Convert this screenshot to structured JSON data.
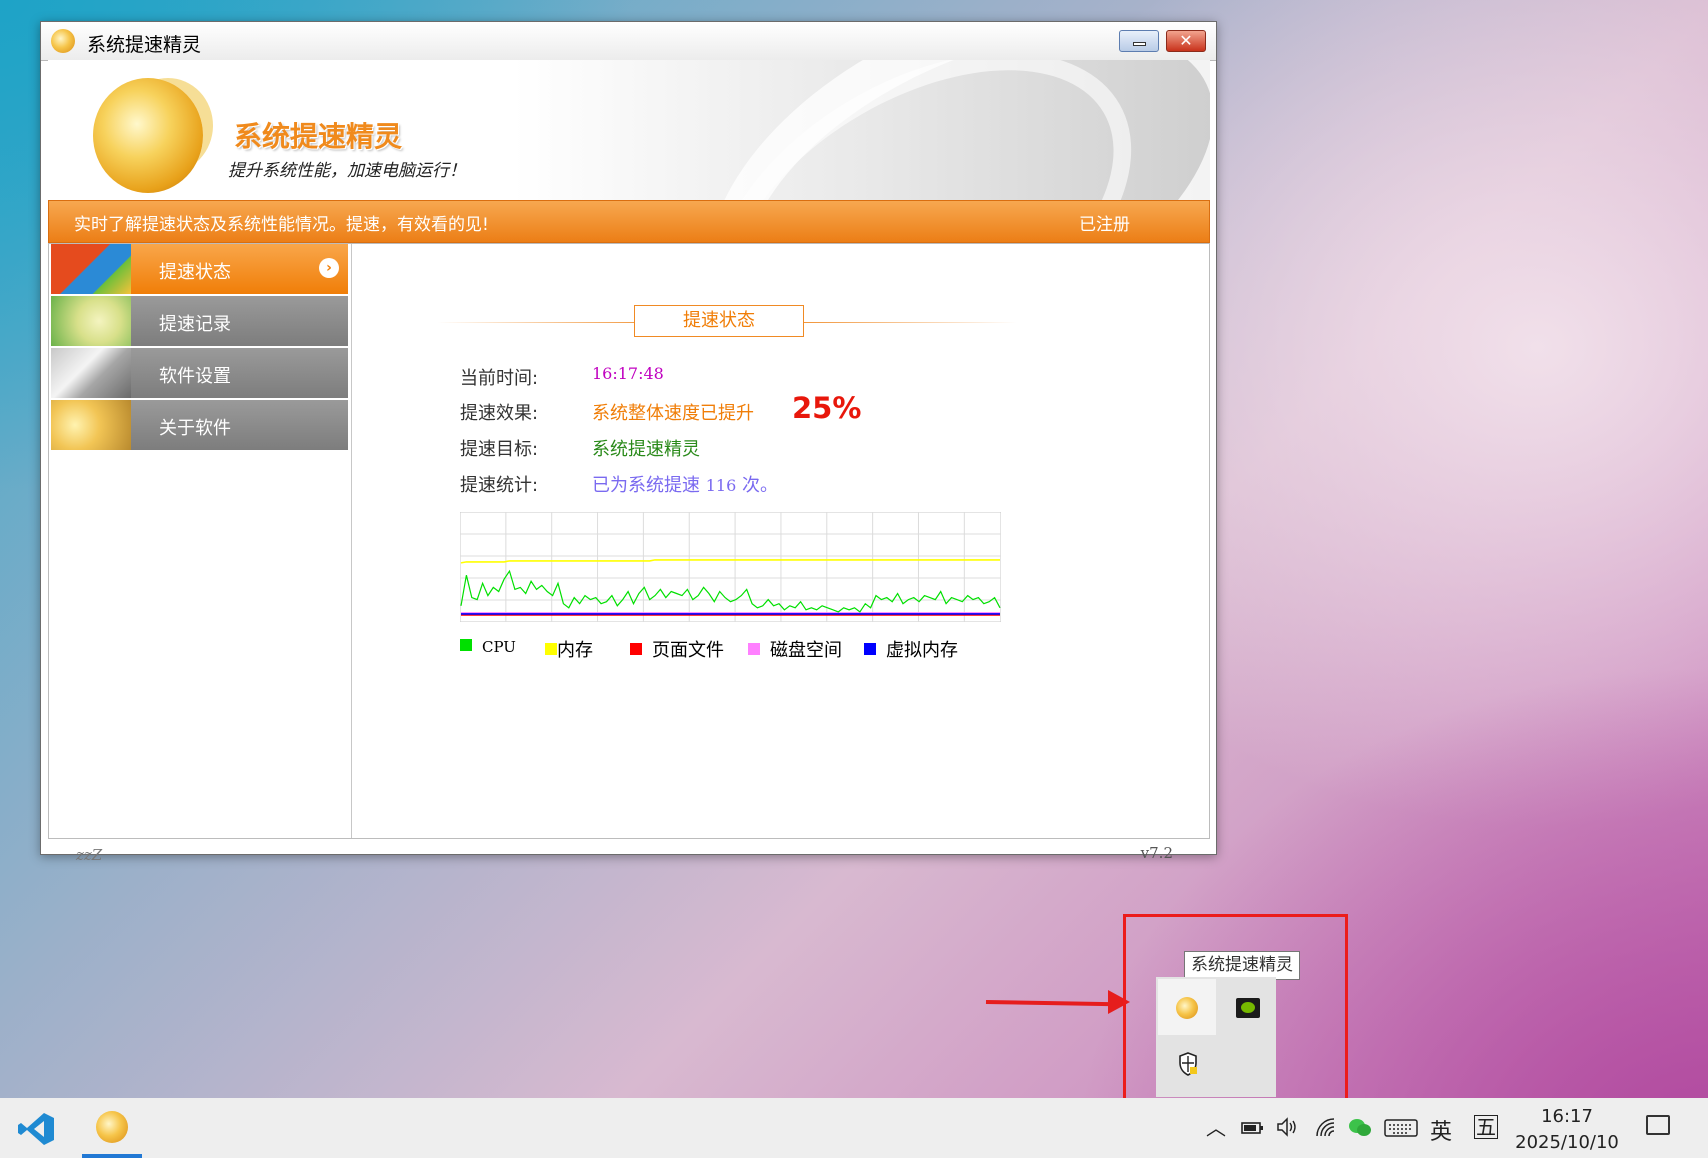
{
  "window": {
    "title": "系统提速精灵",
    "close_glyph": "✕"
  },
  "banner": {
    "title": "系统提速精灵",
    "subtitle": "提升系统性能，加速电脑运行！"
  },
  "info_bar": {
    "tip": "实时了解提速状态及系统性能情况。提速，有效看的见!",
    "registered": "已注册"
  },
  "sidebar": {
    "items": [
      {
        "label": "提速状态",
        "icon": "windows-logo-icon",
        "active": true
      },
      {
        "label": "提速记录",
        "icon": "record-icon",
        "active": false
      },
      {
        "label": "软件设置",
        "icon": "tools-icon",
        "active": false
      },
      {
        "label": "关于软件",
        "icon": "about-icon",
        "active": false
      }
    ],
    "active_arrow": "›"
  },
  "status_panel": {
    "section_title": "提速状态",
    "rows": [
      {
        "key": "当前时间:",
        "value": "16:17:48"
      },
      {
        "key": "提速效果:",
        "value": "系统整体速度已提升",
        "extra": "25%"
      },
      {
        "key": "提速目标:",
        "value": "系统提速精灵"
      },
      {
        "key": "提速统计:",
        "value_prefix": "已为系统提速",
        "value_num": "116",
        "value_suffix": "次。"
      }
    ]
  },
  "chart_data": {
    "type": "line",
    "title": "",
    "xlabel": "",
    "ylabel": "",
    "ylim": [
      0,
      100
    ],
    "grid": true,
    "legend": "bottom",
    "series": [
      {
        "name": "CPU",
        "color": "#00e000",
        "values": [
          12,
          42,
          20,
          18,
          34,
          22,
          30,
          26,
          38,
          46,
          28,
          30,
          24,
          36,
          28,
          32,
          26,
          22,
          34,
          14,
          10,
          20,
          14,
          22,
          18,
          20,
          14,
          16,
          22,
          12,
          18,
          26,
          14,
          24,
          30,
          18,
          22,
          28,
          20,
          26,
          24,
          22,
          28,
          18,
          22,
          30,
          24,
          16,
          26,
          20,
          16,
          18,
          22,
          28,
          14,
          10,
          12,
          18,
          12,
          14,
          8,
          12,
          10,
          16,
          8,
          10,
          8,
          12,
          10,
          8,
          6,
          10,
          8,
          10,
          6,
          14,
          10,
          22,
          18,
          20,
          16,
          24,
          14,
          18,
          20,
          16,
          22,
          20,
          18,
          26,
          14,
          20,
          18,
          16,
          22,
          18,
          20,
          14,
          16,
          20,
          10
        ]
      },
      {
        "name": "内存",
        "color": "#ffff00",
        "values": [
          54,
          55,
          55,
          55,
          55,
          55,
          55,
          55,
          55,
          56,
          56,
          56,
          56,
          56,
          56,
          56,
          56,
          56,
          56,
          56,
          56,
          56,
          56,
          56,
          56,
          56,
          56,
          56,
          56,
          56,
          56,
          56,
          56,
          56,
          56,
          56,
          57,
          57,
          57,
          57,
          57,
          57,
          57,
          57,
          57,
          57,
          57,
          57,
          57,
          57,
          57,
          57,
          57,
          57,
          57,
          57,
          57,
          57,
          57,
          57,
          57,
          57,
          57,
          57,
          57,
          57,
          57,
          57,
          57,
          57,
          57,
          57,
          57,
          57,
          57,
          57,
          57,
          57,
          57,
          57,
          57,
          57,
          57,
          57,
          57,
          57,
          57,
          57,
          57,
          57,
          57,
          57,
          57,
          57,
          57,
          57,
          57,
          57,
          57,
          57,
          57
        ]
      },
      {
        "name": "页面文件",
        "color": "#ff0000",
        "values": [
          3,
          3,
          3,
          3,
          3,
          3,
          3,
          3,
          3,
          3,
          3,
          3,
          3,
          3,
          3,
          3,
          3,
          3,
          3,
          3,
          3,
          3,
          3,
          3,
          3,
          3,
          3,
          3,
          3,
          3,
          3,
          3,
          3,
          3,
          3,
          3,
          3,
          3,
          3,
          3,
          3,
          3,
          3,
          3,
          3,
          3,
          3,
          3,
          3,
          3,
          3,
          3,
          3,
          3,
          3,
          3,
          3,
          3,
          3,
          3,
          3,
          3,
          3,
          3,
          3,
          3,
          3,
          3,
          3,
          3,
          3,
          3,
          3,
          3,
          3,
          3,
          3,
          3,
          3,
          3,
          3,
          3,
          3,
          3,
          3,
          3,
          3,
          3,
          3,
          3,
          3,
          3,
          3,
          3,
          3,
          3,
          3,
          3,
          3,
          3,
          3
        ]
      },
      {
        "name": "磁盘空间",
        "color": "#ff80ff",
        "values": [
          5,
          5,
          5,
          5,
          5,
          5,
          5,
          5,
          5,
          5,
          5,
          5,
          5,
          5,
          5,
          5,
          5,
          5,
          5,
          5,
          5,
          5,
          5,
          5,
          5,
          5,
          5,
          5,
          5,
          5,
          5,
          5,
          5,
          5,
          5,
          5,
          5,
          5,
          5,
          5,
          5,
          5,
          5,
          5,
          5,
          5,
          5,
          5,
          5,
          5,
          5,
          5,
          5,
          5,
          5,
          5,
          5,
          5,
          5,
          5,
          5,
          5,
          5,
          5,
          5,
          5,
          5,
          5,
          5,
          5,
          5,
          5,
          5,
          5,
          5,
          5,
          5,
          5,
          5,
          5,
          5,
          5,
          5,
          5,
          5,
          5,
          5,
          5,
          5,
          5,
          5,
          5,
          5,
          5,
          5,
          5,
          5,
          5,
          5,
          5,
          5
        ]
      },
      {
        "name": "虚拟内存",
        "color": "#0000ff",
        "values": [
          4,
          4,
          4,
          4,
          4,
          4,
          4,
          4,
          4,
          4,
          4,
          4,
          4,
          4,
          4,
          4,
          4,
          4,
          4,
          4,
          4,
          4,
          4,
          4,
          4,
          4,
          4,
          4,
          4,
          4,
          4,
          4,
          4,
          4,
          4,
          4,
          4,
          4,
          4,
          4,
          4,
          4,
          4,
          4,
          4,
          4,
          4,
          4,
          4,
          4,
          4,
          4,
          4,
          4,
          4,
          4,
          4,
          4,
          4,
          4,
          4,
          4,
          4,
          4,
          4,
          4,
          4,
          4,
          4,
          4,
          4,
          4,
          4,
          4,
          4,
          4,
          4,
          4,
          4,
          4,
          4,
          4,
          4,
          4,
          4,
          4,
          4,
          4,
          4,
          4,
          4,
          4,
          4,
          4,
          4,
          4,
          4,
          4,
          4,
          4,
          4
        ]
      }
    ]
  },
  "footer": {
    "left": "zzZ",
    "version": "v7.2"
  },
  "tray_popup": {
    "tooltip": "系统提速精灵",
    "icons": [
      "speedup-app-icon",
      "nvidia-icon",
      "security-shield-icon"
    ]
  },
  "taskbar": {
    "apps": [
      "vscode-icon",
      "speedup-app-icon"
    ],
    "chevron": "︿",
    "ime_lang": "英",
    "ime_mode": "五",
    "time": "16:17",
    "date": "2025/10/10"
  },
  "colors": {
    "accent_orange": "#f07e08",
    "annotation_red": "#ec1c1c"
  }
}
